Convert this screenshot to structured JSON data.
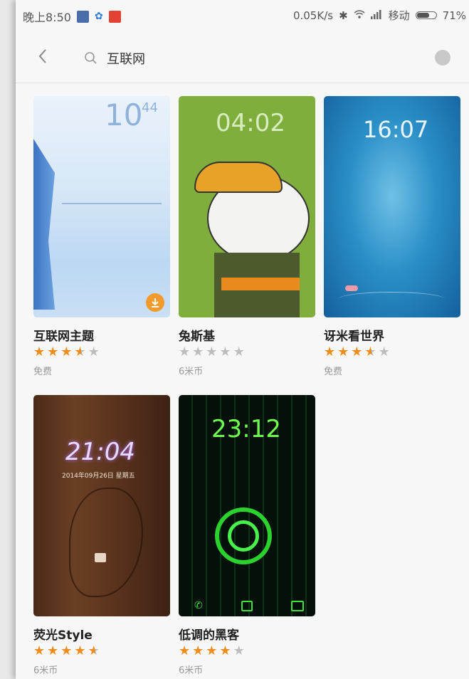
{
  "status_bar": {
    "time": "晚上8:50",
    "net_speed": "0.05K/s",
    "carrier": "移动",
    "battery": "71%",
    "battery_level": 0.71
  },
  "search": {
    "query": "互联网"
  },
  "themes": [
    {
      "name": "互联网主题",
      "rating": 3.5,
      "price": "免费",
      "preview_time": "10",
      "preview_time_small": "44"
    },
    {
      "name": "兔斯基",
      "rating": 0,
      "price": "6米币",
      "preview_time": "04:02"
    },
    {
      "name": "讶米看世界",
      "rating": 3.5,
      "price": "免费",
      "preview_time": "16:07"
    },
    {
      "name": "荧光Style",
      "rating": 4.5,
      "price": "6米币",
      "preview_time": "21:04",
      "preview_date": "2014年09月26日  星期五"
    },
    {
      "name": "低调的黑客",
      "rating": 4,
      "price": "6米币",
      "preview_time": "23:12"
    }
  ],
  "colors": {
    "star_on": "#f08c1b",
    "star_off": "#bdbdbd",
    "download_badge": "#f39a2c"
  }
}
